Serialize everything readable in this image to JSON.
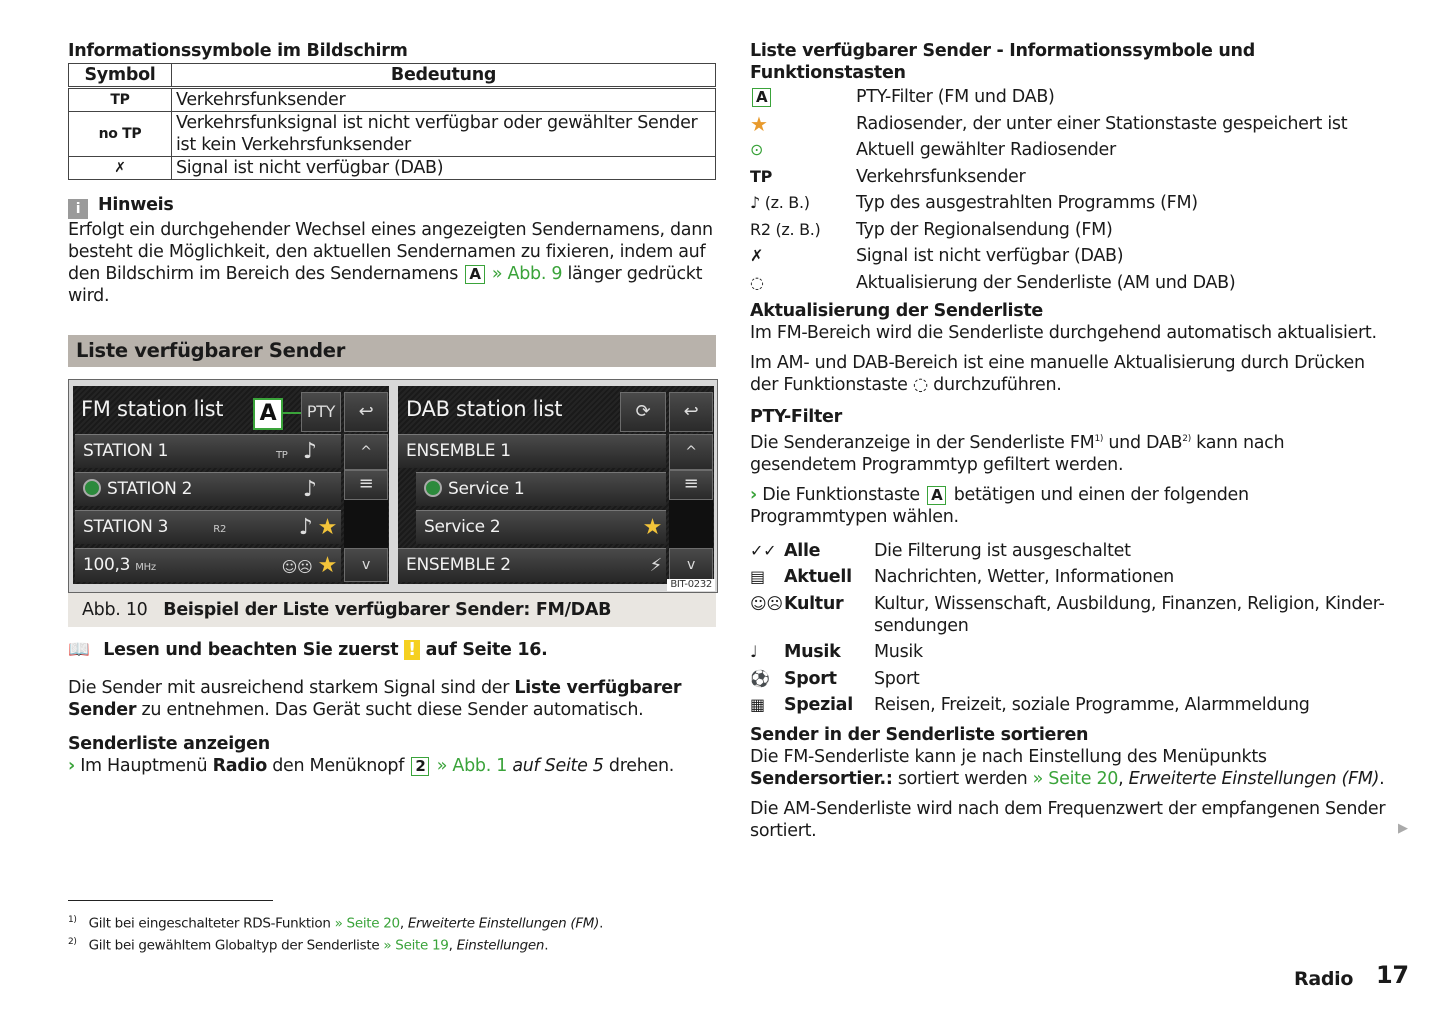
{
  "left": {
    "table_title": "Informationssymbole im Bildschirm",
    "table": {
      "headers": [
        "Symbol",
        "Bedeutung"
      ],
      "rows": [
        {
          "symbol": "TP",
          "icon": "tp-icon",
          "text": "Verkehrsfunksender"
        },
        {
          "symbol": "no TP",
          "icon": "no-tp-icon",
          "text": "Verkehrsfunksignal ist nicht verfügbar oder gewählter Sender ist kein Verkehrsfunksender"
        },
        {
          "symbol": "✗",
          "icon": "no-signal-antenna-icon",
          "text": "Signal ist nicht verfügbar (DAB)"
        }
      ]
    },
    "hinweis": {
      "icon": "i",
      "title": "Hinweis",
      "text_1": "Erfolgt ein durchgehender Wechsel eines angezeigten Sendernamens, dann besteht die Möglichkeit, den aktuellen Sendernamen zu fixieren, indem auf den Bildschirm im Bereich des Sendernamens",
      "box": "A",
      "link": "» Abb. 9",
      "text_2": "länger gedrückt wird."
    },
    "section_title": "Liste verfügbarer Sender",
    "figure": {
      "fm": {
        "title": "FM station list",
        "callout": "A",
        "pty_button": "PTY",
        "back_icon": "↩",
        "rows": [
          {
            "name": "STATION 1",
            "tag": "TP",
            "icons": [
              "music-note"
            ],
            "star": false
          },
          {
            "name": "STATION 2",
            "tag": "",
            "icons": [
              "music-note"
            ],
            "playing": true,
            "star": false
          },
          {
            "name": "STATION 3",
            "tag": "R2",
            "icons": [
              "music-note"
            ],
            "star": true
          },
          {
            "name": "100,3",
            "unit": "MHz",
            "tag": "",
            "icons": [
              "theater-masks"
            ],
            "star": true
          }
        ]
      },
      "dab": {
        "title": "DAB station list",
        "refresh_icon": "⟳",
        "back_icon": "↩",
        "rows": [
          {
            "name": "ENSEMBLE 1",
            "level": 0
          },
          {
            "name": "Service 1",
            "level": 1,
            "playing": true
          },
          {
            "name": "Service 2",
            "level": 1,
            "star": true
          },
          {
            "name": "ENSEMBLE 2",
            "level": 0,
            "no_signal": true
          }
        ]
      },
      "scroll_up": "^",
      "scroll_mid": "≡",
      "scroll_down": "v",
      "image_id": "BIT-0232",
      "caption_num": "Abb. 10",
      "caption_text": "Beispiel der Liste verfügbarer Sender: FM/DAB"
    },
    "read_first": {
      "text_1": "Lesen und beachten Sie zuerst",
      "warn": "!",
      "text_2": "auf Seite 16."
    },
    "intro": {
      "text_1": "Die Sender mit ausreichend starkem Signal sind der",
      "bold": "Liste verfügbarer Sender",
      "text_2": "zu entnehmen. Das Gerät sucht diese Sender automatisch."
    },
    "show_list": {
      "title": "Senderliste anzeigen",
      "step_1": "Im Hauptmenü",
      "step_bold": "Radio",
      "step_2": "den Menüknopf",
      "box": "2",
      "link": "» Abb. 1",
      "italic": "auf Seite 5",
      "step_3": "drehen."
    }
  },
  "right": {
    "legend_title": "Liste verfügbarer Sender - Informationssymbole und Funktionstasten",
    "legend": [
      {
        "symbol": "A",
        "icon": "pty-box-icon",
        "text": "PTY-Filter (FM und DAB)"
      },
      {
        "symbol": "★",
        "icon": "star-icon",
        "text": "Radiosender, der unter einer Stationstaste gespeichert ist"
      },
      {
        "symbol": "▶",
        "icon": "play-circle-icon",
        "text": "Aktuell gewählter Radiosender"
      },
      {
        "symbol": "TP",
        "icon": "tp-icon",
        "text": "Verkehrsfunksender"
      },
      {
        "symbol": "♪ (z. B.)",
        "icon": "music-note-icon",
        "text": "Typ des ausgestrahlten Programms (FM)"
      },
      {
        "symbol": "R2 (z. B.)",
        "icon": "r2-icon",
        "text": "Typ der Regionalsendung (FM)"
      },
      {
        "symbol": "✗",
        "icon": "no-signal-antenna-icon",
        "text": "Signal ist nicht verfügbar (DAB)"
      },
      {
        "symbol": "◌",
        "icon": "refresh-icon",
        "text": "Aktualisierung der Senderliste (AM und DAB)"
      }
    ],
    "update": {
      "title": "Aktualisierung der Senderliste",
      "p1": "Im FM-Bereich wird die Senderliste durchgehend automatisch aktualisiert.",
      "p2_1": "Im AM- und DAB-Bereich ist eine manuelle Aktualisierung durch Drücken der Funktionstaste",
      "p2_2": "durchzuführen."
    },
    "pty": {
      "title": "PTY-Filter",
      "p1_1": "Die Senderanzeige in der Senderliste FM",
      "fn1": "1)",
      "p1_2": "und DAB",
      "fn2": "2)",
      "p1_3": "kann nach gesendetem Programmtyp gefiltert werden.",
      "step_1": "Die Funktionstaste",
      "box": "A",
      "step_2": "betätigen und einen der folgenden Programmtypen wählen."
    },
    "filters": [
      {
        "icon": "✓✓",
        "name": "Alle",
        "desc": "Die Filterung ist ausgeschaltet"
      },
      {
        "icon": "▤",
        "name": "Aktuell",
        "desc": "Nachrichten, Wetter, Informationen"
      },
      {
        "icon": "☺☹",
        "name": "Kultur",
        "desc": "Kultur, Wissenschaft, Ausbildung, Finanzen, Religion, Kinder-sendungen"
      },
      {
        "icon": "♩",
        "name": "Musik",
        "desc": "Musik"
      },
      {
        "icon": "⚽",
        "name": "Sport",
        "desc": "Sport"
      },
      {
        "icon": "▦",
        "name": "Spezial",
        "desc": "Reisen, Freizeit, soziale Programme, Alarmmeldung"
      }
    ],
    "sort": {
      "title": "Sender in der Senderliste sortieren",
      "p1_1": "Die FM-Senderliste kann je nach Einstellung des Menüpunkts",
      "p1_bold": "Sendersortier.:",
      "p1_2": "sortiert werden",
      "p1_link": "» Seite 20",
      "p1_italic": "Erweiterte Einstellungen (FM)",
      "p2": "Die AM-Senderliste wird nach dem Frequenzwert der empfangenen Sender sortiert."
    }
  },
  "footnotes": [
    {
      "num": "1)",
      "text": "Gilt bei eingeschalteter RDS-Funktion",
      "link": "» Seite 20",
      "italic": "Erweiterte Einstellungen (FM)"
    },
    {
      "num": "2)",
      "text": "Gilt bei gewähltem Globaltyp der Senderliste",
      "link": "» Seite 19",
      "italic": "Einstellungen"
    }
  ],
  "footer": {
    "section": "Radio",
    "page": "17",
    "next_icon": "▶"
  },
  "colors": {
    "accent_green": "#3aa33a",
    "star": "#f3c43a",
    "section_bar": "#b8b2ab",
    "caption_bg": "#e9e6e1",
    "warning": "#f5d020"
  }
}
